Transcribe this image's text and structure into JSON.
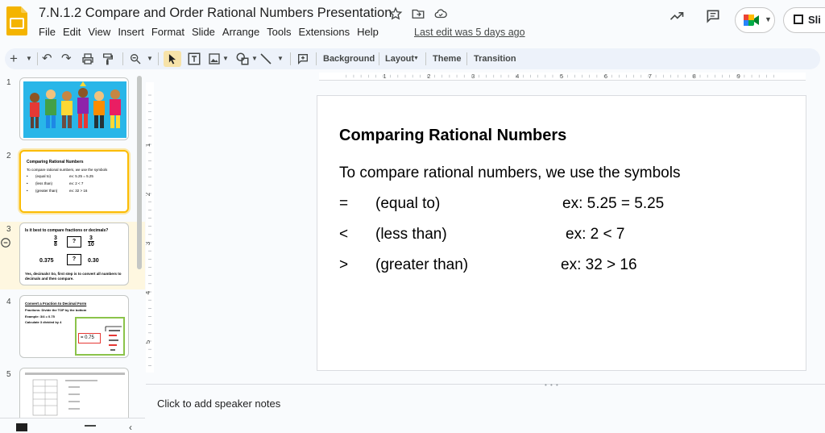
{
  "header": {
    "title": "7.N.1.2 Compare and Order Rational Numbers Presentation",
    "menu": [
      "File",
      "Edit",
      "View",
      "Insert",
      "Format",
      "Slide",
      "Arrange",
      "Tools",
      "Extensions",
      "Help"
    ],
    "last_edit": "Last edit was 5 days ago",
    "slideshow_label": "Sli"
  },
  "toolbar": {
    "background": "Background",
    "layout": "Layout",
    "theme": "Theme",
    "transition": "Transition"
  },
  "rulers": {
    "h_ticks": [
      "1",
      "2",
      "3",
      "4",
      "5",
      "6",
      "7",
      "8",
      "9"
    ],
    "v_ticks": [
      "1",
      "2",
      "3",
      "4",
      "5"
    ]
  },
  "filmstrip": {
    "numbers": [
      "1",
      "2",
      "3",
      "4",
      "5"
    ],
    "slide2": {
      "title": "Comparing Rational Numbers",
      "intro": "To compare rational numbers, we use the symbols",
      "rows": [
        {
          "desc": "(equal to)",
          "ex": "ex:  5.25 = 5.25"
        },
        {
          "desc": "(less than)",
          "ex": "ex:  2 < 7"
        },
        {
          "desc": "(greater than)",
          "ex": "ex: 32 > 16"
        }
      ]
    },
    "slide3": {
      "question": "Is it best to compare fractions or decimals?",
      "frac1_num": "3",
      "frac1_den": "8",
      "q": "?",
      "frac2_num": "3",
      "frac2_den": "10",
      "dec1": "0.375",
      "dec2": "0.30",
      "answer": "Yes, decimals! So, first step is to convert all numbers to decimals and then compare."
    },
    "slide4": {
      "title": "Convert a Fraction to Decimal Form",
      "line1": "Fractions: Divide the TOP by the bottom",
      "line2": "Example: 3/4 = 0.75",
      "line3": "Calculate 3 divided by 4",
      "result": "= 0.75"
    }
  },
  "slide": {
    "title": "Comparing Rational Numbers",
    "intro": "To compare rational numbers, we use the symbols",
    "rows": [
      {
        "symbol": "=",
        "desc": "(equal to)",
        "ex": "ex:  5.25 = 5.25"
      },
      {
        "symbol": "<",
        "desc": "(less than)",
        "ex": "ex:  2 < 7"
      },
      {
        "symbol": ">",
        "desc": "(greater than)",
        "ex": "ex: 32 > 16"
      }
    ]
  },
  "notes": {
    "placeholder": "Click to add speaker notes"
  },
  "colors": {
    "selected_border": "#fbbc04",
    "toolbar_bg": "#edf2fa",
    "thumb1_bg": "#29b6e8"
  }
}
